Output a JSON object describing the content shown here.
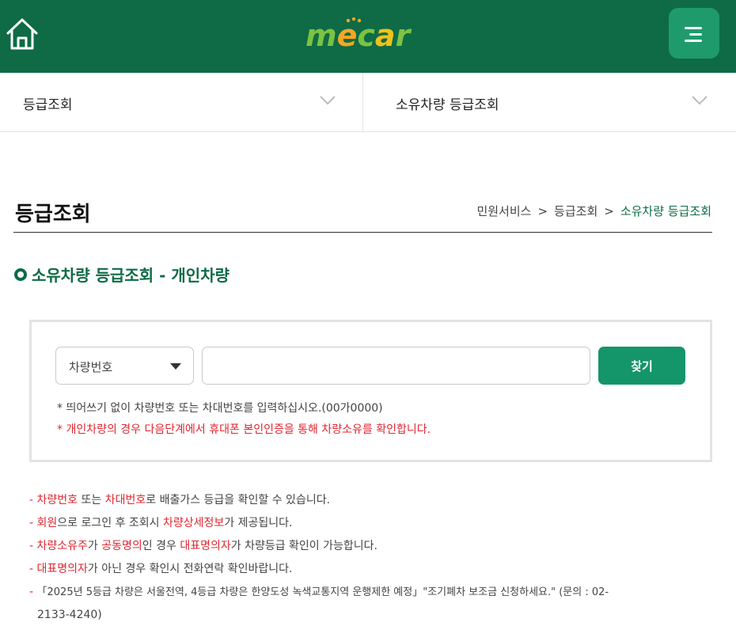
{
  "header": {
    "logo_text": "mecar",
    "home_icon": "home-icon",
    "menu_icon": "menu-icon",
    "colors": {
      "bg": "#0e6b45",
      "menu_bg": "#1f9a6d"
    }
  },
  "selectors": {
    "first": "등급조회",
    "second": "소유차량 등급조회"
  },
  "page": {
    "title": "등급조회",
    "breadcrumb": [
      "민원서비스",
      "등급조회",
      "소유차량 등급조회"
    ],
    "breadcrumb_sep": ">",
    "section_title": "소유차량 등급조회 - 개인차량"
  },
  "search": {
    "type_selected": "차량번호",
    "input_value": "",
    "button_label": "찾기",
    "hint1": "* 띄어쓰기 없이 차량번호 또는 차대번호를 입력하십시오.(00가0000)",
    "hint2": "* 개인차량의 경우 다음단계에서 휴대폰 본인인증을 통해 차량소유를 확인합니다."
  },
  "notes": {
    "dash": "-",
    "n1": {
      "a": "차량번호",
      "b": " 또는 ",
      "c": "차대번호",
      "d": "로 배출가스 등급을 확인할 수 있습니다."
    },
    "n2": {
      "a": "회원",
      "b": "으로 로그인 후 조회시 ",
      "c": "차량상세정보",
      "d": "가 제공됩니다."
    },
    "n3": {
      "a": "차량소유주",
      "b": "가 ",
      "c": "공동명의",
      "d": "인 경우 ",
      "e": "대표명의자",
      "f": "가 차량등급 확인이 가능합니다."
    },
    "n4": {
      "a": "대표명의자",
      "b": "가 아닌 경우 확인시 전화연락 확인바랍니다."
    },
    "n5": {
      "line1": "「2025년 5등급 차량은 서울전역, 4등급 차량은 한양도성 녹색교통지역 운행제한 예정」\"조기폐차 보조금 신청하세요.\" (문의 : 02-",
      "line2": "2133-4240)"
    }
  }
}
